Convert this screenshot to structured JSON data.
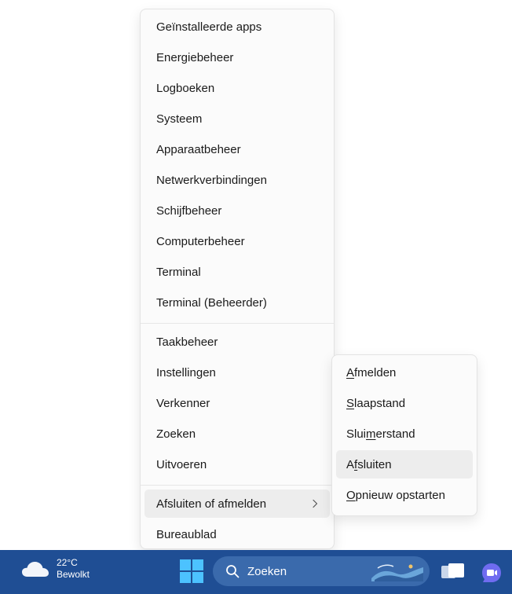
{
  "menu": {
    "items": [
      {
        "label": "Geïnstalleerde apps"
      },
      {
        "label": "Energiebeheer"
      },
      {
        "label": "Logboeken"
      },
      {
        "label": "Systeem"
      },
      {
        "label": "Apparaatbeheer"
      },
      {
        "label": "Netwerkverbindingen"
      },
      {
        "label": "Schijfbeheer"
      },
      {
        "label": "Computerbeheer"
      },
      {
        "label": "Terminal"
      },
      {
        "label": "Terminal (Beheerder)"
      },
      {
        "label": "Taakbeheer"
      },
      {
        "label": "Instellingen"
      },
      {
        "label": "Verkenner"
      },
      {
        "label": "Zoeken"
      },
      {
        "label": "Uitvoeren"
      },
      {
        "label": "Afsluiten of afmelden"
      },
      {
        "label": "Bureaublad"
      }
    ]
  },
  "submenu": {
    "items": [
      {
        "pre": "",
        "u": "A",
        "post": "fmelden"
      },
      {
        "pre": "",
        "u": "S",
        "post": "laapstand"
      },
      {
        "pre": "Slui",
        "u": "m",
        "post": "erstand"
      },
      {
        "pre": "A",
        "u": "f",
        "post": "sluiten"
      },
      {
        "pre": "",
        "u": "O",
        "post": "pnieuw opstarten"
      }
    ]
  },
  "taskbar": {
    "weather": {
      "temp": "22°C",
      "condition": "Bewolkt",
      "icon": "cloud-icon"
    },
    "search": {
      "placeholder": "Zoeken"
    },
    "colors": {
      "background": "#1f4e94",
      "search_bg": "#3a6aac"
    }
  }
}
